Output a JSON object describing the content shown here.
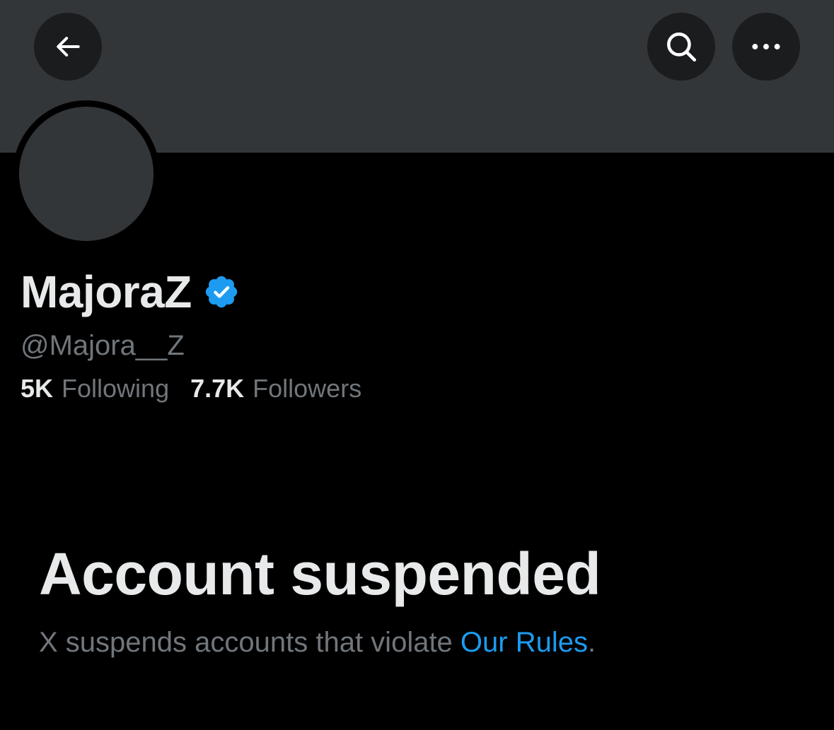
{
  "header": {
    "back_icon": "arrow-left-icon",
    "search_icon": "search-icon",
    "more_icon": "more-horizontal-icon"
  },
  "profile": {
    "display_name": "MajoraZ",
    "verified_icon": "verified-badge-icon",
    "handle": "@Majora__Z",
    "following_count": "5K",
    "following_label": "Following",
    "followers_count": "7.7K",
    "followers_label": "Followers"
  },
  "suspension": {
    "title": "Account suspended",
    "description": "X suspends accounts that violate ",
    "rules_link": "Our Rules",
    "period": "."
  },
  "colors": {
    "background": "#000000",
    "banner": "#333639",
    "button_background": "#1b1c1e",
    "primary_text": "#e7e9ea",
    "secondary_text": "#71767b",
    "link": "#1d9bf0",
    "verified_badge": "#1d9bf0"
  }
}
